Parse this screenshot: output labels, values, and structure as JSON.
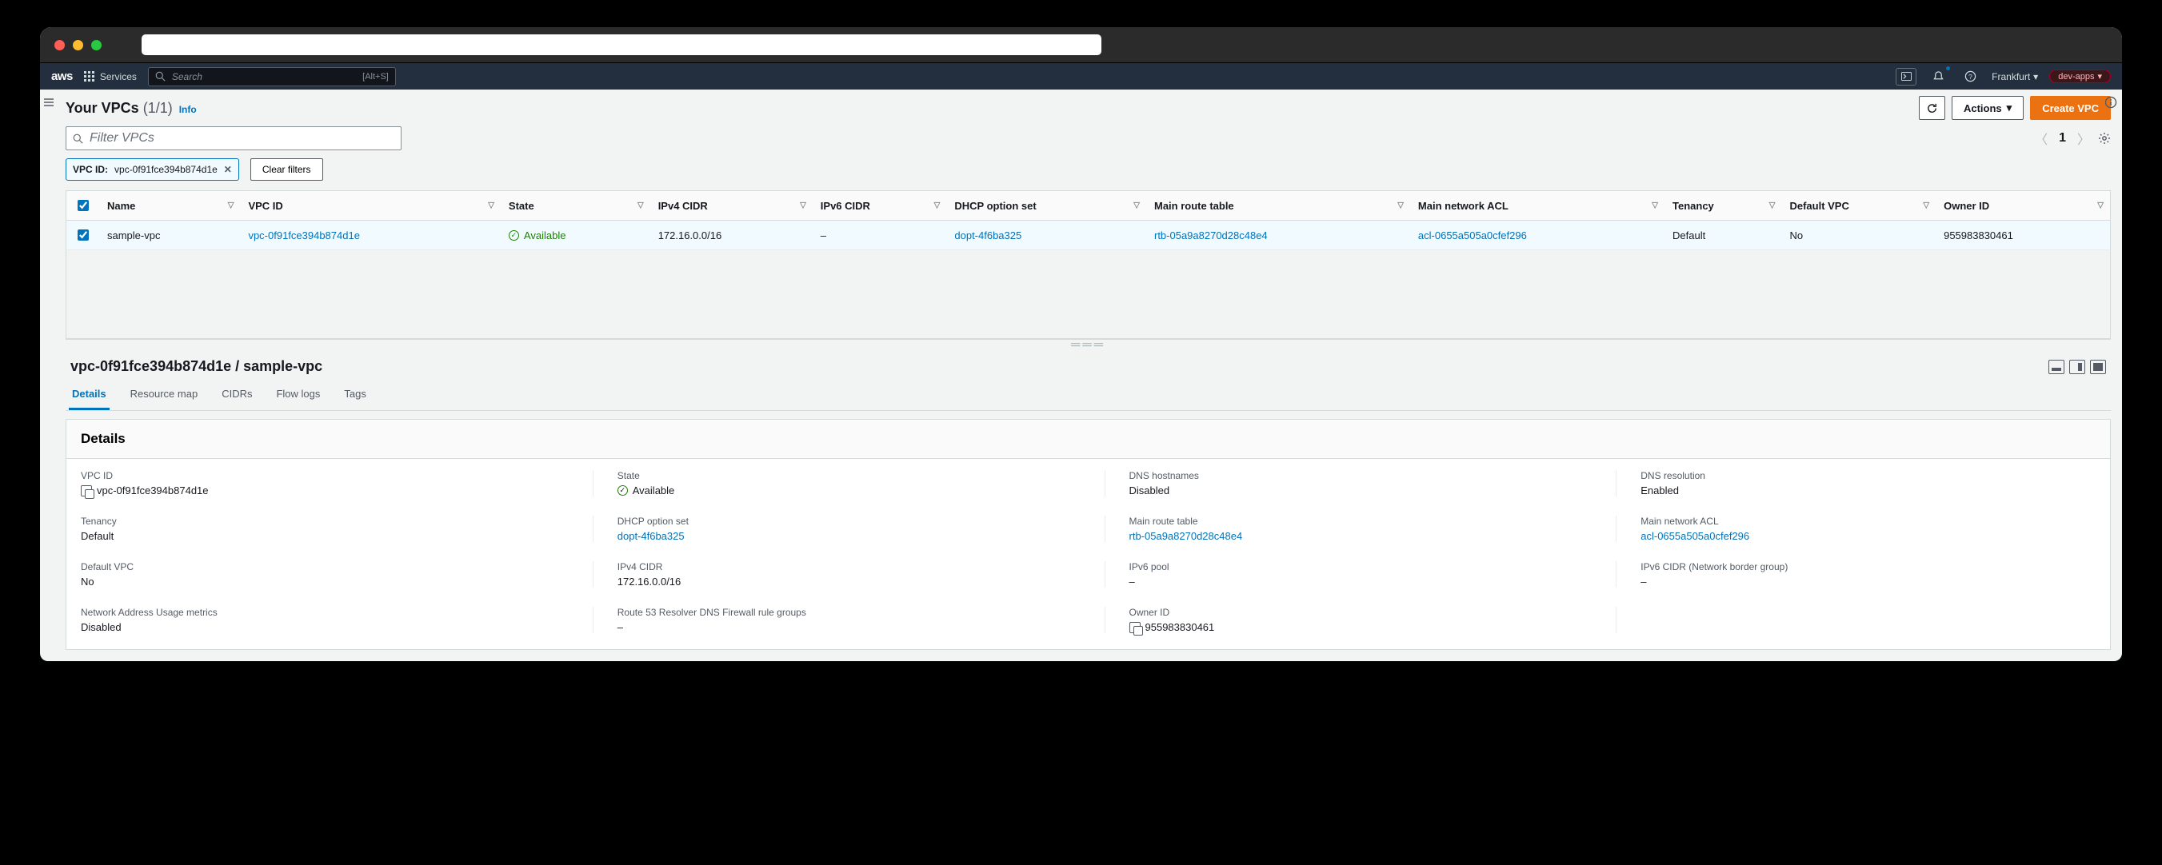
{
  "nav": {
    "logo": "aws",
    "services": "Services",
    "search_placeholder": "Search",
    "search_kbd": "[Alt+S]",
    "region": "Frankfurt",
    "role": "dev-apps"
  },
  "header": {
    "title": "Your VPCs",
    "count": "(1/1)",
    "info": "Info",
    "refresh_aria": "Refresh",
    "actions": "Actions",
    "create": "Create VPC"
  },
  "filter": {
    "placeholder": "Filter VPCs",
    "chip_key": "VPC ID:",
    "chip_val": "vpc-0f91fce394b874d1e",
    "clear": "Clear filters",
    "page": "1"
  },
  "columns": [
    "Name",
    "VPC ID",
    "State",
    "IPv4 CIDR",
    "IPv6 CIDR",
    "DHCP option set",
    "Main route table",
    "Main network ACL",
    "Tenancy",
    "Default VPC",
    "Owner ID"
  ],
  "row": {
    "name": "sample-vpc",
    "vpc_id": "vpc-0f91fce394b874d1e",
    "state": "Available",
    "ipv4": "172.16.0.0/16",
    "ipv6": "–",
    "dhcp": "dopt-4f6ba325",
    "rtb": "rtb-05a9a8270d28c48e4",
    "acl": "acl-0655a505a0cfef296",
    "tenancy": "Default",
    "default_vpc": "No",
    "owner": "955983830461"
  },
  "detail": {
    "title": "vpc-0f91fce394b874d1e / sample-vpc",
    "tabs": [
      "Details",
      "Resource map",
      "CIDRs",
      "Flow logs",
      "Tags"
    ],
    "panel_title": "Details",
    "fields": {
      "vpc_id_k": "VPC ID",
      "vpc_id_v": "vpc-0f91fce394b874d1e",
      "state_k": "State",
      "state_v": "Available",
      "dnsh_k": "DNS hostnames",
      "dnsh_v": "Disabled",
      "dnsr_k": "DNS resolution",
      "dnsr_v": "Enabled",
      "tenancy_k": "Tenancy",
      "tenancy_v": "Default",
      "dhcp_k": "DHCP option set",
      "dhcp_v": "dopt-4f6ba325",
      "rtb_k": "Main route table",
      "rtb_v": "rtb-05a9a8270d28c48e4",
      "acl_k": "Main network ACL",
      "acl_v": "acl-0655a505a0cfef296",
      "defvpc_k": "Default VPC",
      "defvpc_v": "No",
      "ipv4_k": "IPv4 CIDR",
      "ipv4_v": "172.16.0.0/16",
      "ipv6p_k": "IPv6 pool",
      "ipv6p_v": "–",
      "ipv6c_k": "IPv6 CIDR (Network border group)",
      "ipv6c_v": "–",
      "naum_k": "Network Address Usage metrics",
      "naum_v": "Disabled",
      "r53_k": "Route 53 Resolver DNS Firewall rule groups",
      "r53_v": "–",
      "owner_k": "Owner ID",
      "owner_v": "955983830461"
    }
  }
}
